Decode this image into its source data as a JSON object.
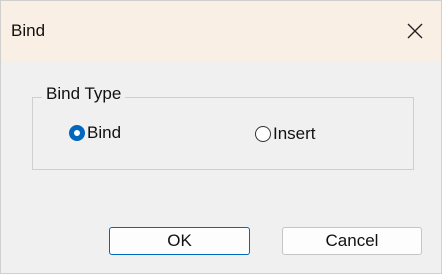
{
  "window": {
    "title": "Bind",
    "close_icon": "close-icon"
  },
  "group": {
    "legend": "Bind Type",
    "options": [
      {
        "label": "Bind",
        "checked": true
      },
      {
        "label": "Insert",
        "checked": false
      }
    ]
  },
  "buttons": {
    "ok_label": "OK",
    "cancel_label": "Cancel"
  },
  "colors": {
    "accent": "#0067c0",
    "titlebar_bg": "#f9efe4",
    "dialog_bg": "#f0f0f0"
  }
}
